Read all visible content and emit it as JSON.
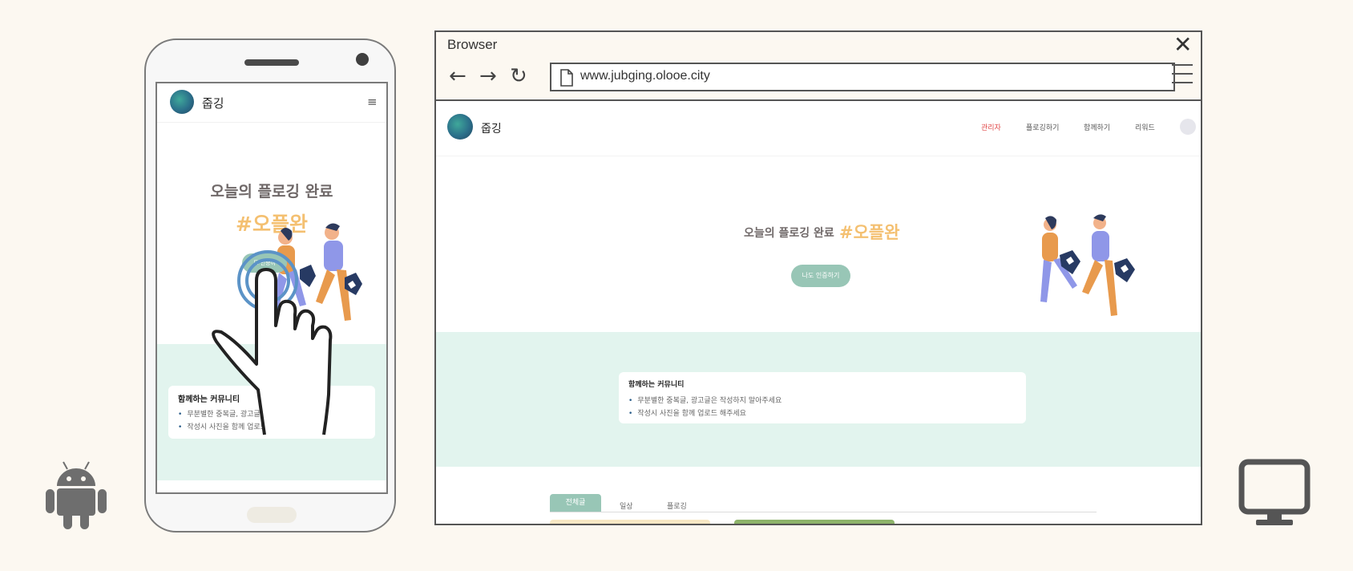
{
  "platform_icons": {
    "android": "android-icon",
    "desktop": "monitor-icon"
  },
  "mobile": {
    "brand": "줍깅",
    "hero_title": "오늘의 플로깅 완료",
    "hashtag": "#오플완",
    "button_label": "나도 인증하기",
    "button_label_visible": "도 인증하",
    "community": {
      "title": "함께하는 커뮤니티",
      "items": [
        "무분별한 중복글, 광고글은",
        "작성시 사진을 함께 업로드 해"
      ]
    }
  },
  "browser": {
    "title": "Browser",
    "url": "www.jubging.olooe.city",
    "site": {
      "brand": "줍깅",
      "nav": [
        "관리자",
        "플로깅하기",
        "함께하기",
        "리워드"
      ],
      "hero_title": "오늘의 플로깅 완료",
      "hashtag": "#오플완",
      "button_label": "나도 인증하기",
      "community": {
        "title": "함께하는 커뮤니티",
        "items": [
          "무분별한 중복글, 광고글은 작성하지 말아주세요",
          "작성시 사진을 함께 업로드 해주세요"
        ]
      },
      "tabs": [
        "전체글",
        "일상",
        "플로깅"
      ]
    }
  },
  "colors": {
    "background": "#fcf8f1",
    "mint": "#e2f4ee",
    "accent_green": "#98c6b6",
    "hashtag_orange": "#f4c071",
    "admin_red": "#e14b4b",
    "touch_ring": "#5b93c7"
  }
}
